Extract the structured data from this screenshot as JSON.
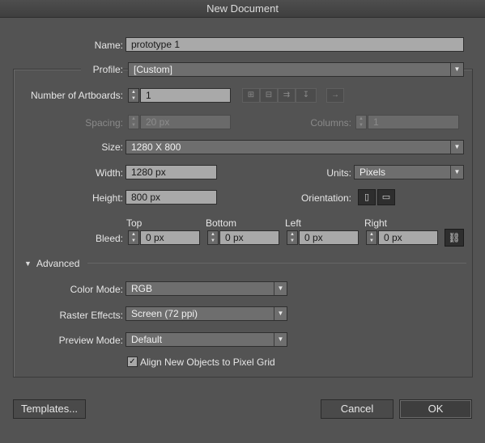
{
  "window": {
    "title": "New Document"
  },
  "name": {
    "label": "Name:",
    "value": "prototype 1"
  },
  "profile": {
    "label": "Profile:",
    "value": "[Custom]"
  },
  "artboards": {
    "label": "Number of Artboards:",
    "value": "1"
  },
  "spacing": {
    "label": "Spacing:",
    "value": "20 px"
  },
  "columns": {
    "label": "Columns:",
    "value": "1"
  },
  "size": {
    "label": "Size:",
    "value": "1280 X 800"
  },
  "width": {
    "label": "Width:",
    "value": "1280 px"
  },
  "units": {
    "label": "Units:",
    "value": "Pixels"
  },
  "height": {
    "label": "Height:",
    "value": "800 px"
  },
  "orientation": {
    "label": "Orientation:",
    "portrait_icon": "portrait-icon",
    "landscape_icon": "landscape-icon"
  },
  "bleed": {
    "label": "Bleed:",
    "top": {
      "label": "Top",
      "value": "0 px"
    },
    "bottom": {
      "label": "Bottom",
      "value": "0 px"
    },
    "left": {
      "label": "Left",
      "value": "0 px"
    },
    "right": {
      "label": "Right",
      "value": "0 px"
    }
  },
  "advanced": {
    "label": "Advanced",
    "expanded": true
  },
  "color_mode": {
    "label": "Color Mode:",
    "value": "RGB"
  },
  "raster_effects": {
    "label": "Raster Effects:",
    "value": "Screen (72 ppi)"
  },
  "preview_mode": {
    "label": "Preview Mode:",
    "value": "Default"
  },
  "align_pixel_grid": {
    "label": "Align New Objects to Pixel Grid",
    "checked": true
  },
  "buttons": {
    "templates": "Templates...",
    "cancel": "Cancel",
    "ok": "OK"
  }
}
